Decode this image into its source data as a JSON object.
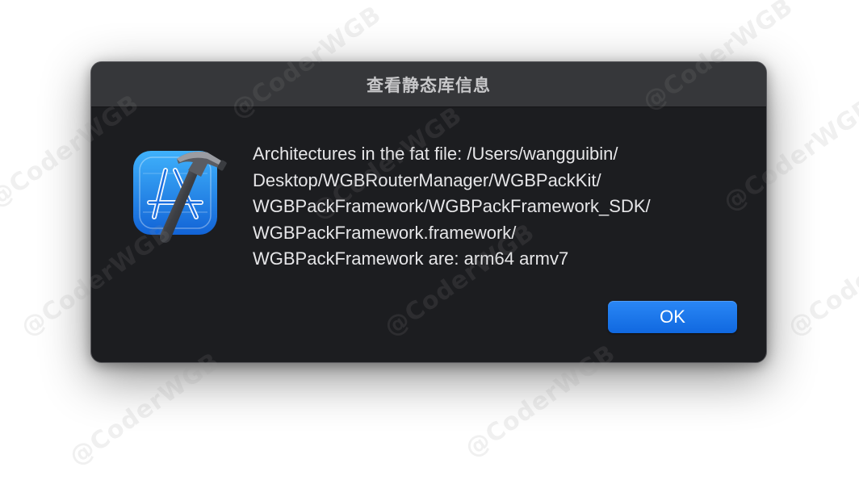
{
  "dialog": {
    "title": "查看静态库信息",
    "icon": "xcode-app-icon",
    "message": "Architectures in the fat file: /Users/wangguibin/\nDesktop/WGBRouterManager/WGBPackKit/\nWGBPackFramework/WGBPackFramework_SDK/\nWGBPackFramework.framework/\nWGBPackFramework are: arm64 armv7",
    "ok_label": "OK"
  },
  "watermark": {
    "text": "@CoderWGB"
  },
  "colors": {
    "dialog_bg": "#1c1d20",
    "titlebar_bg": "#36373a",
    "accent": "#1a77ea"
  }
}
